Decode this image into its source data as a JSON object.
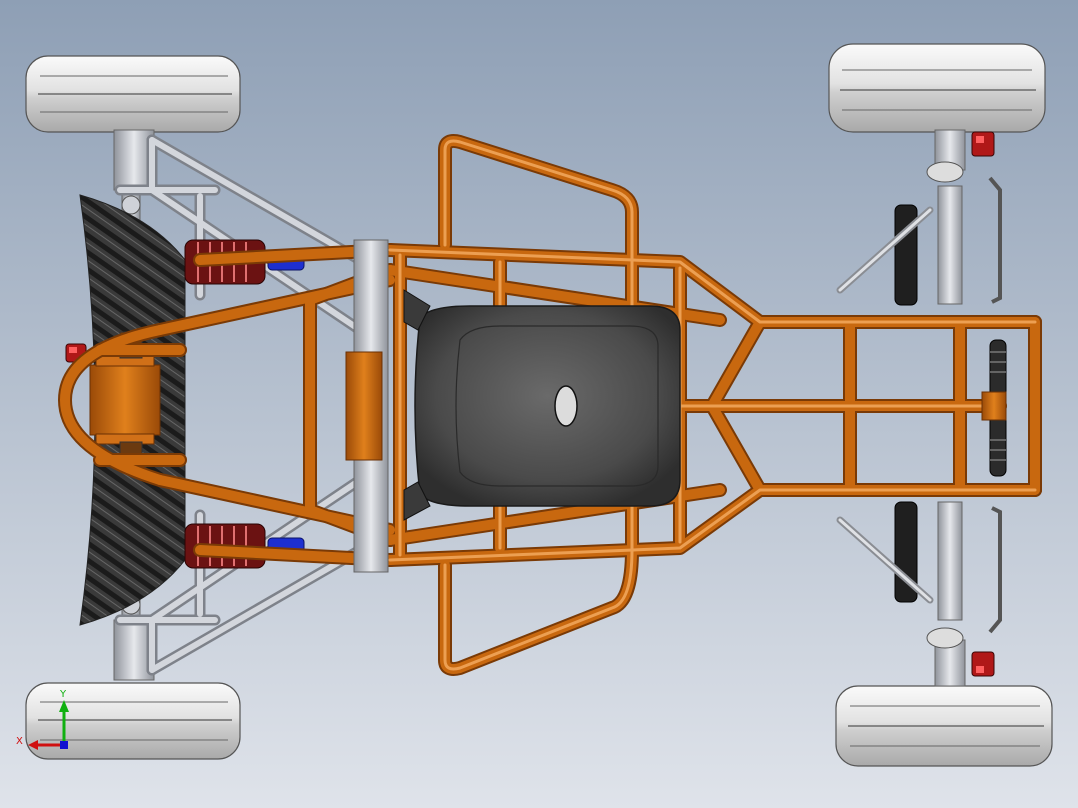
{
  "viewport": {
    "background_top": "#8e9fb5",
    "background_bottom": "#dfe3ea"
  },
  "model": {
    "frame_color": "#c8680f",
    "frame_highlight": "#f2a052",
    "frame_shadow": "#7a3a06",
    "steel_color": "#b9bcc3",
    "tire_color": "#e6e6e6",
    "seat_color": "#4a4a4a",
    "spring_color": "#8b1a1a",
    "caliper_color": "#b01818",
    "damper_color": "#1f1f1f",
    "accent_blue": "#1d2fd0"
  },
  "triad": {
    "x_label": "X",
    "y_label": "Y",
    "x_color": "#d01010",
    "y_color": "#10b010",
    "z_color": "#1010d0"
  }
}
